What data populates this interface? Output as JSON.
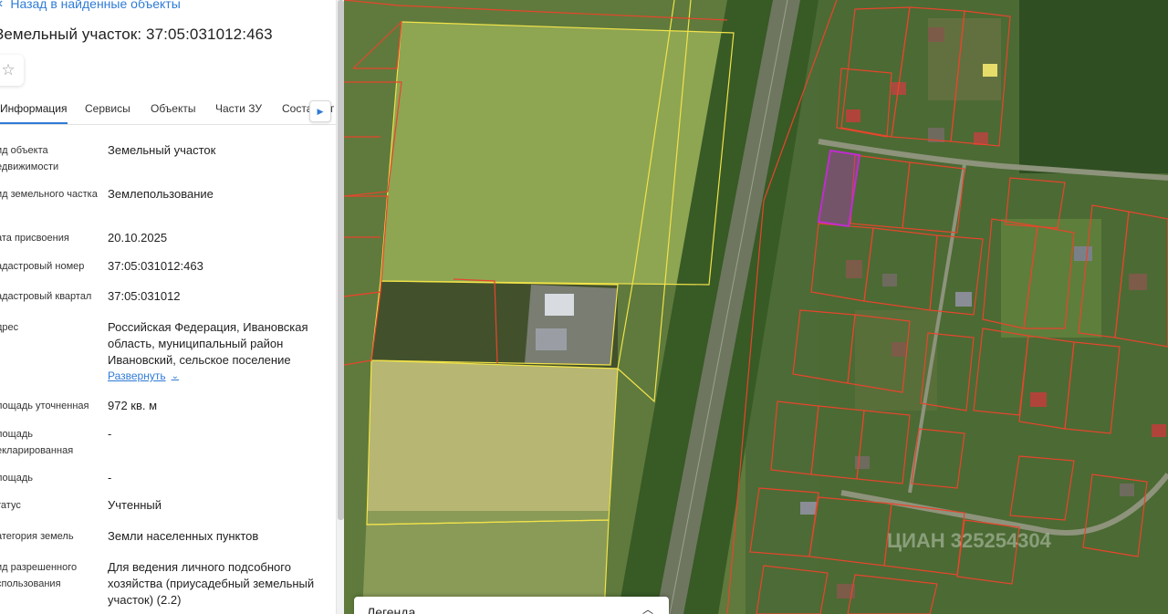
{
  "back_link": "Назад в найденные объекты",
  "title": "Земельный участок: 37:05:031012:463",
  "tabs": [
    "Информация",
    "Сервисы",
    "Объекты",
    "Части ЗУ",
    "Соста"
  ],
  "tab_tail": "г",
  "fields": {
    "object_type": {
      "label": "ид объекта едвижимости",
      "value": "Земельный участок"
    },
    "land_type": {
      "label": "ид земельного частка",
      "value": "Землепользование"
    },
    "date_assigned": {
      "label": "ата присвоения",
      "value": "20.10.2025"
    },
    "cadastral_number": {
      "label": "адастровый номер",
      "value": "37:05:031012:463"
    },
    "cadastral_quarter": {
      "label": "адастровый квартал",
      "value": "37:05:031012"
    },
    "address": {
      "label": "дрес",
      "value": "Российская Федерация, Ивановская область, муниципальный район Ивановский, сельское поселение"
    },
    "area_specified": {
      "label": "лощадь уточненная",
      "value": "972 кв. м"
    },
    "area_declared": {
      "label": "лощадь екларированная",
      "value": "-"
    },
    "area": {
      "label": "лощадь",
      "value": "-"
    },
    "status": {
      "label": "татус",
      "value": "Учтенный"
    },
    "land_category": {
      "label": "атегория земель",
      "value": "Земли населенных пунктов"
    },
    "permitted_use": {
      "label": "ид разрешенного спользования",
      "value": "Для ведения личного подсобного хозяйства (приусадебный земельный участок) (2.2)"
    }
  },
  "expand_label": "Развернуть",
  "legend_title": "Легенда",
  "map_watermark": "ЦИАН 325254304",
  "colors": {
    "accent": "#2f7bd6",
    "parcel_border": "#e8452c",
    "selected_parcel": "#c02ccf",
    "field_border": "#f2e34a"
  },
  "icons": {
    "back": "chevron-left-icon",
    "favorite": "star-icon",
    "tabs_next": "chevron-right-icon",
    "expand": "chevron-down-icon",
    "legend_toggle": "chevron-up-icon"
  }
}
